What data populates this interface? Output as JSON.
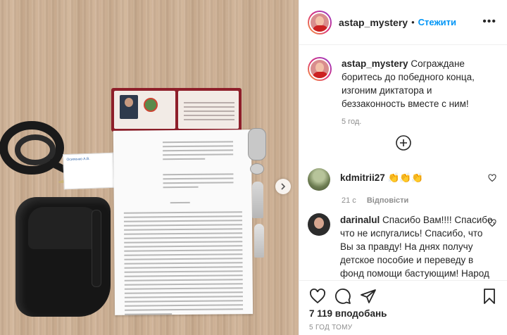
{
  "post": {
    "author": "astap_mystery",
    "follow_label": "Стежити",
    "separator": "•",
    "more_label": "•••"
  },
  "photo": {
    "description_label": "Post photo",
    "card_name": "Осипенко А.В."
  },
  "caption": {
    "author": "astap_mystery",
    "text": "Сограждане боритесь до победного конца, изгоним диктатора и беззаконность вместе с ним!",
    "time": "5 год."
  },
  "comments": [
    {
      "author": "kdmitrii27",
      "text": "👏👏👏",
      "time": "21 с",
      "reply_label": "Відповісти"
    },
    {
      "author": "darinalul",
      "text": "Спасибо Вам!!!! Спасибо, что не испугались! Спасибо, что Вы за правду! На днях получу детское пособие и переведу в фонд помощи бастующим! Народ с вами, и вы с народом!"
    }
  ],
  "stats": {
    "likes": "7 119 вподобань",
    "posted_ago": "5 ГОД ТОМУ"
  },
  "icons": {
    "like": "heart-icon",
    "comment": "comment-icon",
    "share": "paper-plane-icon",
    "save": "bookmark-icon",
    "add": "plus-circle-icon",
    "next": "chevron-right-icon"
  },
  "colors": {
    "link": "#0095f6",
    "text": "#262626",
    "muted": "#8e8e8e",
    "border": "#efefef"
  }
}
